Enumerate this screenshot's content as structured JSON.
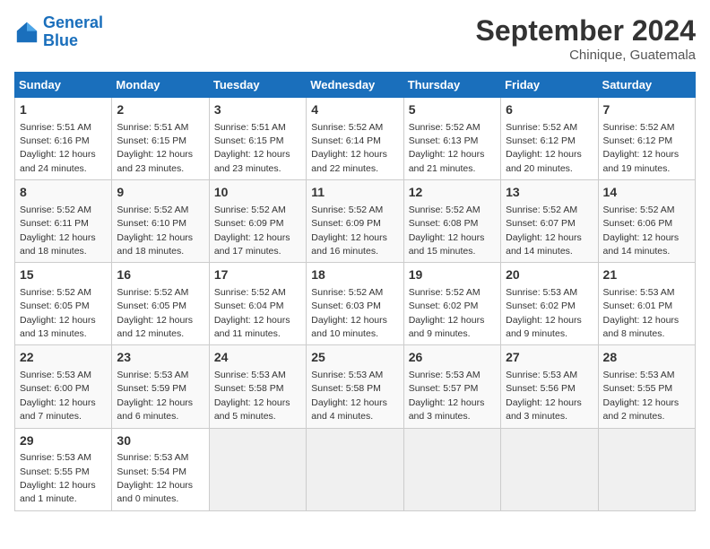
{
  "header": {
    "logo_line1": "General",
    "logo_line2": "Blue",
    "month": "September 2024",
    "location": "Chinique, Guatemala"
  },
  "days_of_week": [
    "Sunday",
    "Monday",
    "Tuesday",
    "Wednesday",
    "Thursday",
    "Friday",
    "Saturday"
  ],
  "weeks": [
    [
      {
        "day": 1,
        "sunrise": "5:51 AM",
        "sunset": "6:16 PM",
        "daylight": "12 hours and 24 minutes."
      },
      {
        "day": 2,
        "sunrise": "5:51 AM",
        "sunset": "6:15 PM",
        "daylight": "12 hours and 23 minutes."
      },
      {
        "day": 3,
        "sunrise": "5:51 AM",
        "sunset": "6:15 PM",
        "daylight": "12 hours and 23 minutes."
      },
      {
        "day": 4,
        "sunrise": "5:52 AM",
        "sunset": "6:14 PM",
        "daylight": "12 hours and 22 minutes."
      },
      {
        "day": 5,
        "sunrise": "5:52 AM",
        "sunset": "6:13 PM",
        "daylight": "12 hours and 21 minutes."
      },
      {
        "day": 6,
        "sunrise": "5:52 AM",
        "sunset": "6:12 PM",
        "daylight": "12 hours and 20 minutes."
      },
      {
        "day": 7,
        "sunrise": "5:52 AM",
        "sunset": "6:12 PM",
        "daylight": "12 hours and 19 minutes."
      }
    ],
    [
      {
        "day": 8,
        "sunrise": "5:52 AM",
        "sunset": "6:11 PM",
        "daylight": "12 hours and 18 minutes."
      },
      {
        "day": 9,
        "sunrise": "5:52 AM",
        "sunset": "6:10 PM",
        "daylight": "12 hours and 18 minutes."
      },
      {
        "day": 10,
        "sunrise": "5:52 AM",
        "sunset": "6:09 PM",
        "daylight": "12 hours and 17 minutes."
      },
      {
        "day": 11,
        "sunrise": "5:52 AM",
        "sunset": "6:09 PM",
        "daylight": "12 hours and 16 minutes."
      },
      {
        "day": 12,
        "sunrise": "5:52 AM",
        "sunset": "6:08 PM",
        "daylight": "12 hours and 15 minutes."
      },
      {
        "day": 13,
        "sunrise": "5:52 AM",
        "sunset": "6:07 PM",
        "daylight": "12 hours and 14 minutes."
      },
      {
        "day": 14,
        "sunrise": "5:52 AM",
        "sunset": "6:06 PM",
        "daylight": "12 hours and 14 minutes."
      }
    ],
    [
      {
        "day": 15,
        "sunrise": "5:52 AM",
        "sunset": "6:05 PM",
        "daylight": "12 hours and 13 minutes."
      },
      {
        "day": 16,
        "sunrise": "5:52 AM",
        "sunset": "6:05 PM",
        "daylight": "12 hours and 12 minutes."
      },
      {
        "day": 17,
        "sunrise": "5:52 AM",
        "sunset": "6:04 PM",
        "daylight": "12 hours and 11 minutes."
      },
      {
        "day": 18,
        "sunrise": "5:52 AM",
        "sunset": "6:03 PM",
        "daylight": "12 hours and 10 minutes."
      },
      {
        "day": 19,
        "sunrise": "5:52 AM",
        "sunset": "6:02 PM",
        "daylight": "12 hours and 9 minutes."
      },
      {
        "day": 20,
        "sunrise": "5:53 AM",
        "sunset": "6:02 PM",
        "daylight": "12 hours and 9 minutes."
      },
      {
        "day": 21,
        "sunrise": "5:53 AM",
        "sunset": "6:01 PM",
        "daylight": "12 hours and 8 minutes."
      }
    ],
    [
      {
        "day": 22,
        "sunrise": "5:53 AM",
        "sunset": "6:00 PM",
        "daylight": "12 hours and 7 minutes."
      },
      {
        "day": 23,
        "sunrise": "5:53 AM",
        "sunset": "5:59 PM",
        "daylight": "12 hours and 6 minutes."
      },
      {
        "day": 24,
        "sunrise": "5:53 AM",
        "sunset": "5:58 PM",
        "daylight": "12 hours and 5 minutes."
      },
      {
        "day": 25,
        "sunrise": "5:53 AM",
        "sunset": "5:58 PM",
        "daylight": "12 hours and 4 minutes."
      },
      {
        "day": 26,
        "sunrise": "5:53 AM",
        "sunset": "5:57 PM",
        "daylight": "12 hours and 3 minutes."
      },
      {
        "day": 27,
        "sunrise": "5:53 AM",
        "sunset": "5:56 PM",
        "daylight": "12 hours and 3 minutes."
      },
      {
        "day": 28,
        "sunrise": "5:53 AM",
        "sunset": "5:55 PM",
        "daylight": "12 hours and 2 minutes."
      }
    ],
    [
      {
        "day": 29,
        "sunrise": "5:53 AM",
        "sunset": "5:55 PM",
        "daylight": "12 hours and 1 minute."
      },
      {
        "day": 30,
        "sunrise": "5:53 AM",
        "sunset": "5:54 PM",
        "daylight": "12 hours and 0 minutes."
      },
      null,
      null,
      null,
      null,
      null
    ]
  ]
}
